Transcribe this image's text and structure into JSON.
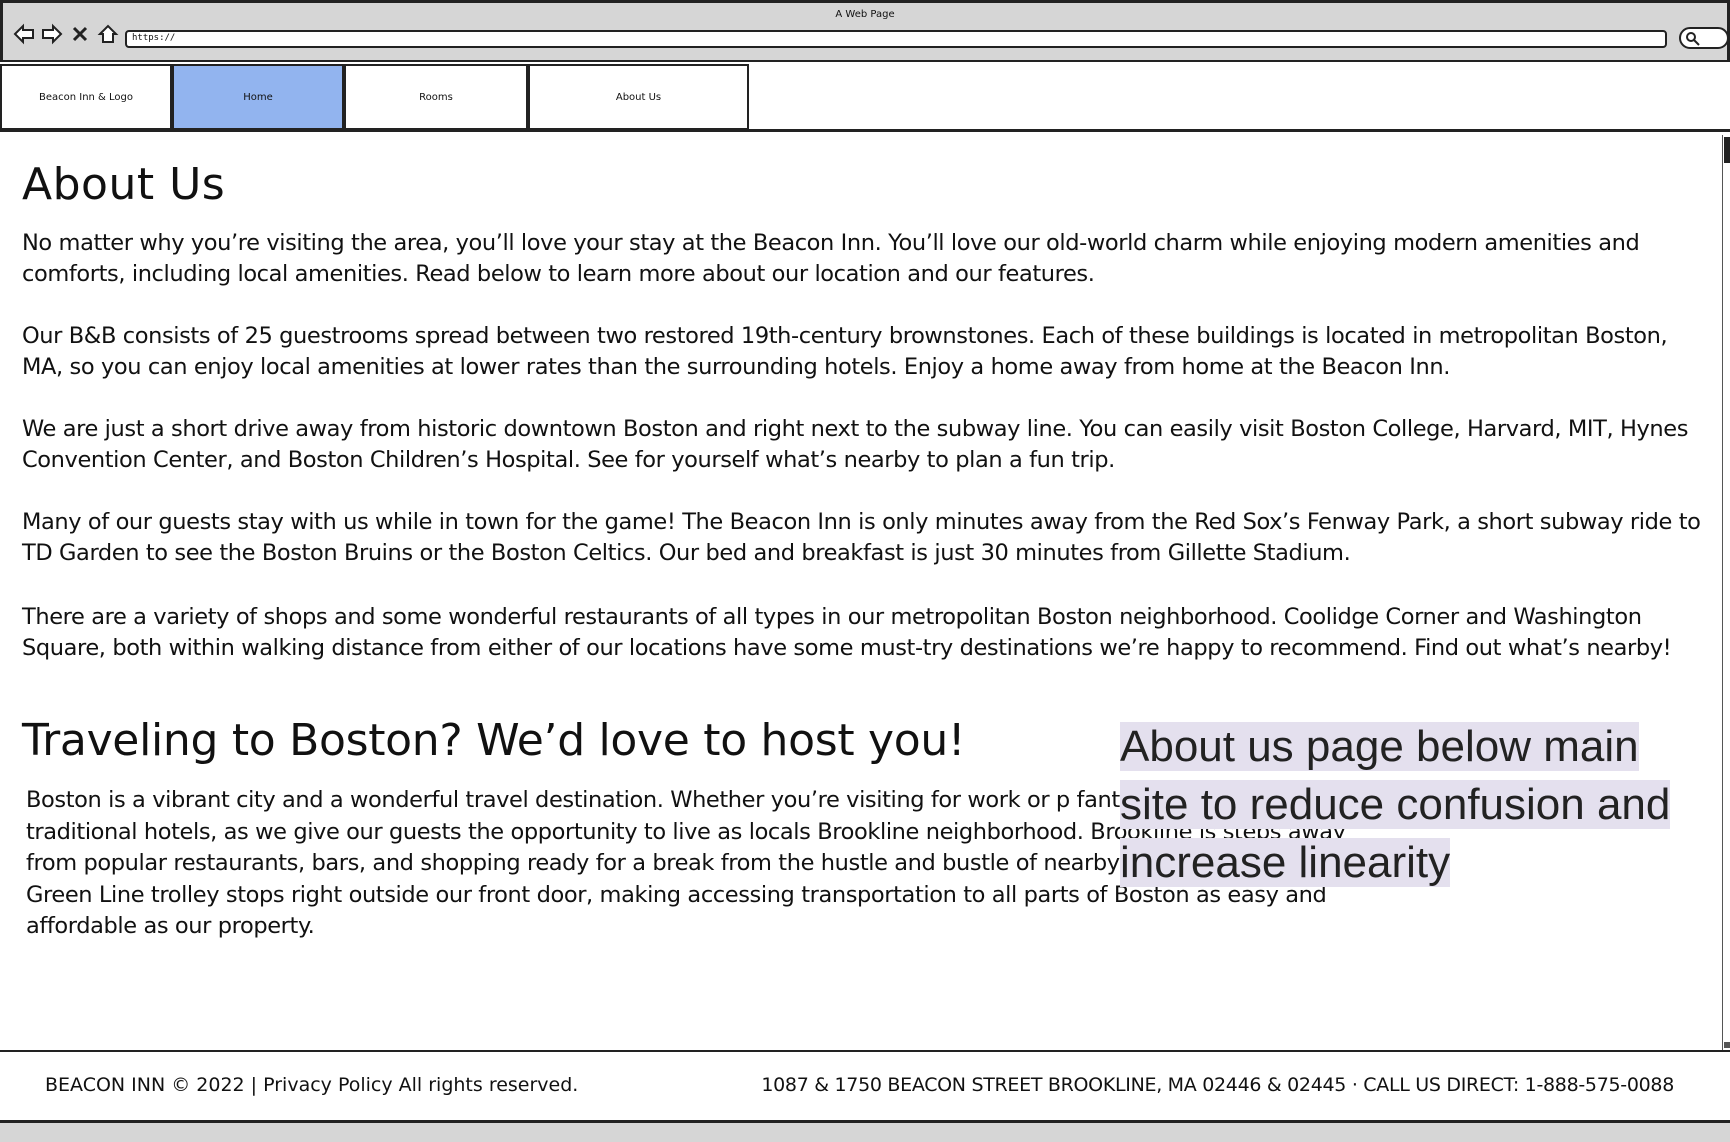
{
  "browser": {
    "window_title": "A Web Page",
    "url": "https://"
  },
  "nav": {
    "logo_label": "Beacon Inn & Logo",
    "tabs": [
      {
        "label": "Home",
        "active": true
      },
      {
        "label": "Rooms",
        "active": false
      },
      {
        "label": "About Us",
        "active": false
      }
    ],
    "active_color": "#92b4ef"
  },
  "about": {
    "title": "About Us",
    "paragraphs": [
      "No matter why you’re visiting the area, you’ll love your stay at the Beacon Inn. You’ll love our old-world charm while enjoying modern amenities and comforts, including local amenities. Read below to learn more about our location and our features.",
      "Our B&B consists of 25 guestrooms spread between two restored 19th-century brownstones. Each of these buildings is located in metropolitan Boston, MA, so you can enjoy local amenities at lower rates than the surrounding hotels. Enjoy a home away from home at the Beacon Inn.",
      "We are just a short drive away from historic downtown Boston and right next to the subway line. You can easily visit Boston College, Harvard, MIT, Hynes Convention Center, and Boston Children’s Hospital. See for yourself what’s nearby to plan a fun trip.",
      "Many of our guests stay with us while in town for the game! The Beacon Inn is only minutes away from the Red Sox’s Fenway Park, a short subway ride to TD Garden to see the Boston Bruins or the Boston Celtics. Our bed and breakfast is just 30 minutes from Gillette Stadium.",
      "There are a variety of shops and some wonderful restaurants of all types in our metropolitan Boston neighborhood. Coolidge Corner and Washington Square, both within walking distance from either of our locations have some must-try destinations we’re happy to recommend. Find out what’s nearby!"
    ]
  },
  "travel": {
    "title": "Traveling to Boston? We’d love to host you!",
    "body": "Boston is a vibrant city and a wonderful travel destination. Whether you’re visiting for work or p fantastic alternative to traditional hotels, as we give our guests the opportunity to live as locals Brookline neighborhood. Brookline is steps away from popular restaurants, bars, and shopping ready for a break from the hustle and bustle of nearby downtown. Boston’s Green Line trolley stops right outside our front door, making accessing transportation to all parts of Boston as easy and affordable as our property."
  },
  "annotation": {
    "text": "About us page below main site to reduce confusion and increase linearity"
  },
  "footer": {
    "left": "BEACON INN © 2022 | Privacy Policy All rights reserved.",
    "right": "1087 & 1750 BEACON STREET BROOKLINE, MA 02446 & 02445 · CALL US DIRECT: 1-888-575-0088"
  }
}
